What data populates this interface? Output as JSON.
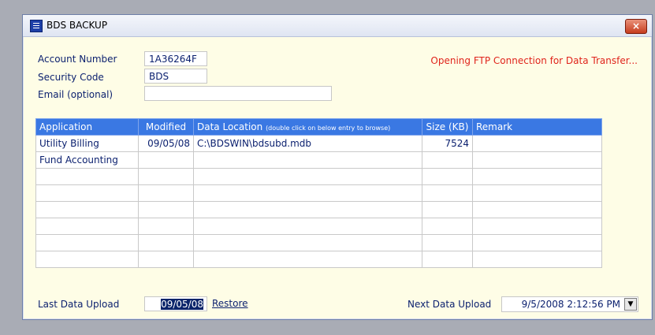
{
  "window": {
    "title": "BDS BACKUP",
    "close_glyph": "×"
  },
  "form": {
    "account_label": "Account Number",
    "account_value": "1A36264F",
    "security_label": "Security Code",
    "security_value": "BDS",
    "email_label": "Email (optional)",
    "email_value": ""
  },
  "status_message": "Opening FTP Connection for Data Transfer...",
  "table": {
    "headers": {
      "application": "Application",
      "modified": "Modified",
      "location": "Data Location",
      "location_hint": "(double click on below entry to browse)",
      "size": "Size (KB)",
      "remark": "Remark"
    },
    "rows": [
      {
        "application": "Utility Billing",
        "modified": "09/05/08",
        "location": "C:\\BDSWIN\\bdsubd.mdb",
        "size": "7524",
        "remark": ""
      },
      {
        "application": "Fund Accounting",
        "modified": "",
        "location": "",
        "size": "",
        "remark": ""
      },
      {
        "application": "",
        "modified": "",
        "location": "",
        "size": "",
        "remark": ""
      },
      {
        "application": "",
        "modified": "",
        "location": "",
        "size": "",
        "remark": ""
      },
      {
        "application": "",
        "modified": "",
        "location": "",
        "size": "",
        "remark": ""
      },
      {
        "application": "",
        "modified": "",
        "location": "",
        "size": "",
        "remark": ""
      },
      {
        "application": "",
        "modified": "",
        "location": "",
        "size": "",
        "remark": ""
      },
      {
        "application": "",
        "modified": "",
        "location": "",
        "size": "",
        "remark": ""
      }
    ]
  },
  "footer": {
    "last_upload_label": "Last Data Upload",
    "last_upload_value": "09/05/08",
    "restore_label": "Restore",
    "next_upload_label": "Next Data Upload",
    "next_upload_value": "9/5/2008 2:12:56 PM",
    "dropdown_glyph": "▼"
  },
  "colors": {
    "header_bg": "#3a78e3",
    "status": "#e0241c",
    "window_bg": "#fefde6"
  }
}
